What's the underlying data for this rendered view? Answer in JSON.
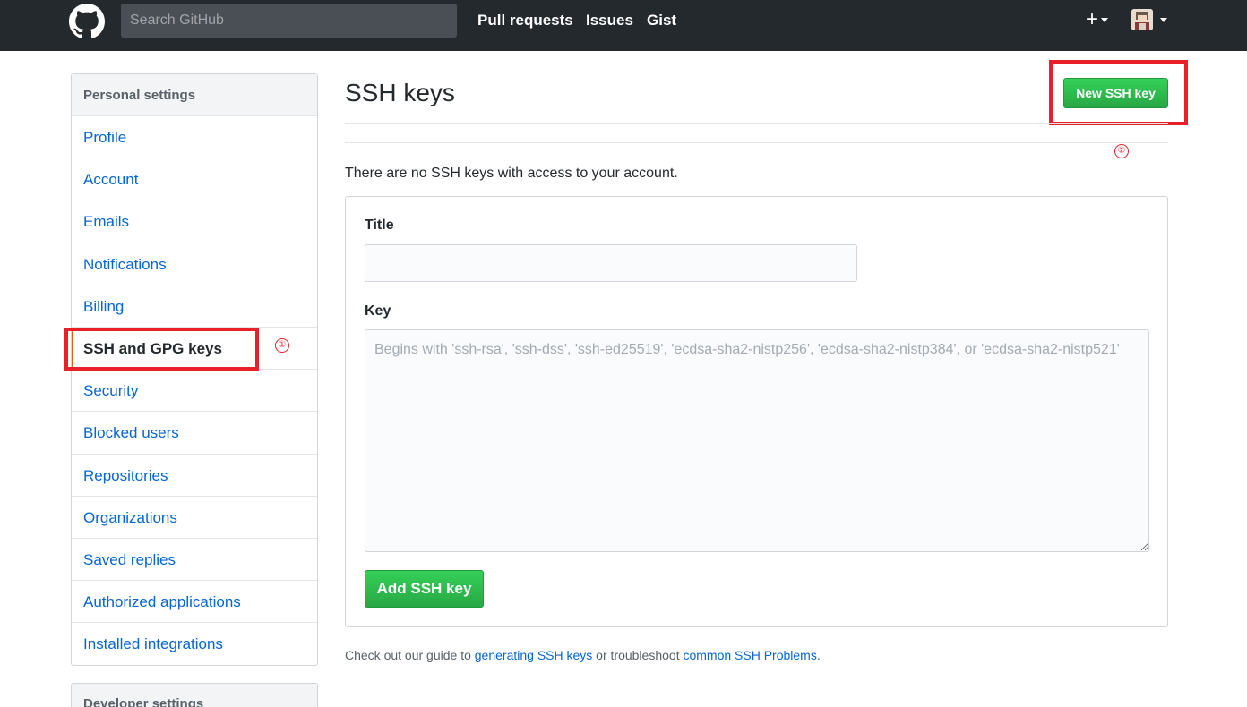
{
  "header": {
    "search_placeholder": "Search GitHub",
    "nav": {
      "pull_requests": "Pull requests",
      "issues": "Issues",
      "gist": "Gist"
    },
    "plus_label": "+"
  },
  "sidebar": {
    "header": "Personal settings",
    "items": [
      {
        "label": "Profile"
      },
      {
        "label": "Account"
      },
      {
        "label": "Emails"
      },
      {
        "label": "Notifications"
      },
      {
        "label": "Billing"
      },
      {
        "label": "SSH and GPG keys"
      },
      {
        "label": "Security"
      },
      {
        "label": "Blocked users"
      },
      {
        "label": "Repositories"
      },
      {
        "label": "Organizations"
      },
      {
        "label": "Saved replies"
      },
      {
        "label": "Authorized applications"
      },
      {
        "label": "Installed integrations"
      }
    ],
    "selected_index": 5,
    "secondary_header": "Developer settings"
  },
  "annotations": {
    "num_1": "①",
    "num_2": "②",
    "color": "#e8202a"
  },
  "main": {
    "title": "SSH keys",
    "new_button": "New SSH key",
    "empty_message": "There are no SSH keys with access to your account.",
    "form": {
      "title_label": "Title",
      "title_value": "",
      "key_label": "Key",
      "key_placeholder": "Begins with 'ssh-rsa', 'ssh-dss', 'ssh-ed25519', 'ecdsa-sha2-nistp256', 'ecdsa-sha2-nistp384', or 'ecdsa-sha2-nistp521'",
      "submit_label": "Add SSH key"
    },
    "footer": {
      "prefix": "Check out our guide to ",
      "link1": "generating SSH keys",
      "middle": " or troubleshoot ",
      "link2": "common SSH Problems",
      "suffix": "."
    }
  },
  "colors": {
    "header_bg": "#24292e",
    "link": "#0366d6",
    "primary_green": "#28a745",
    "selected_accent": "#e36209"
  }
}
